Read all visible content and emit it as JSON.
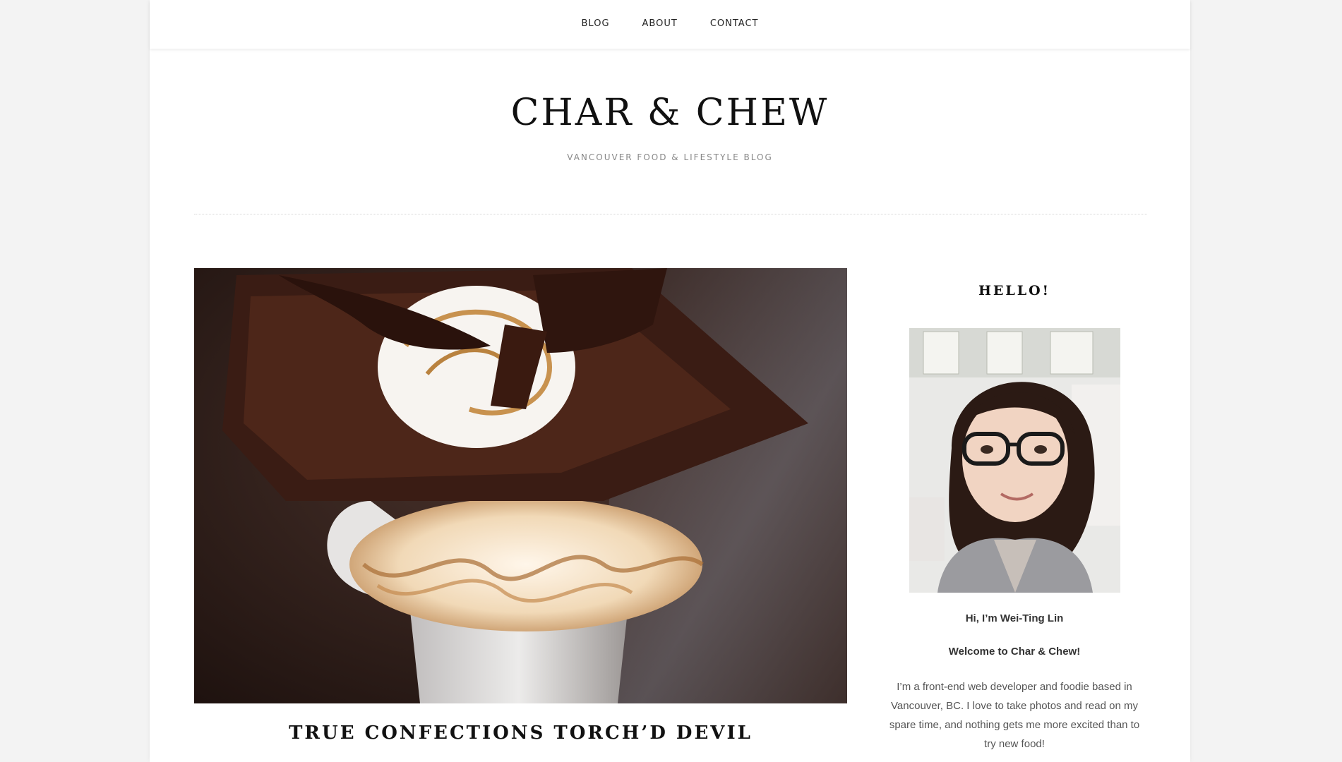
{
  "nav": {
    "items": [
      {
        "label": "BLOG"
      },
      {
        "label": "ABOUT"
      },
      {
        "label": "CONTACT"
      }
    ]
  },
  "site": {
    "title": "CHAR & CHEW",
    "description": "VANCOUVER FOOD & LIFESTYLE BLOG"
  },
  "post": {
    "title": "TRUE CONFECTIONS TORCH’D DEVIL"
  },
  "sidebar": {
    "widget_title": "HELLO!",
    "greeting": "Hi, I’m Wei-Ting Lin",
    "welcome": "Welcome to Char & Chew!",
    "bio": "I’m a front-end web developer and foodie based in Vancouver, BC. I love to take photos and read on my spare time, and nothing gets me more excited than to try new food!"
  }
}
